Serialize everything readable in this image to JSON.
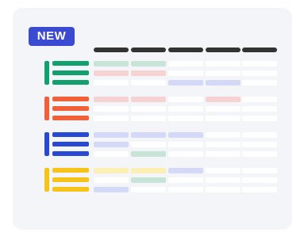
{
  "badge": {
    "label": "NEW"
  },
  "colors": {
    "badge_bg": "#3b4bd1",
    "header": "#333333",
    "green": "#13a06f",
    "orange": "#f0613a",
    "blue": "#2749d6",
    "yellow": "#f7c319",
    "tint_green": "#c8e4d6",
    "tint_red": "#f6d3d2",
    "tint_blue": "#d4d9f7",
    "tint_yellow": "#fbefb3"
  },
  "groups": [
    {
      "name": "green-group",
      "icon_color": "#13a06f",
      "rows": [
        [
          "#c8e4d6",
          "#c8e4d6",
          "#ffffff",
          "#ffffff",
          "#ffffff"
        ],
        [
          "#f6d3d2",
          "#f6d3d2",
          "#ffffff",
          "#ffffff",
          "#ffffff"
        ],
        [
          "#ffffff",
          "#ffffff",
          "#d4d9f7",
          "#d4d9f7",
          "#ffffff"
        ]
      ]
    },
    {
      "name": "orange-group",
      "icon_color": "#f0613a",
      "rows": [
        [
          "#f6d3d2",
          "#f6d3d2",
          "#ffffff",
          "#f6d3d2",
          "#ffffff"
        ],
        [
          "#ffffff",
          "#ffffff",
          "#ffffff",
          "#ffffff",
          "#ffffff"
        ],
        [
          "#ffffff",
          "#ffffff",
          "#ffffff",
          "#ffffff",
          "#ffffff"
        ]
      ]
    },
    {
      "name": "blue-group",
      "icon_color": "#2749d6",
      "rows": [
        [
          "#d4d9f7",
          "#d4d9f7",
          "#d4d9f7",
          "#ffffff",
          "#ffffff"
        ],
        [
          "#d4d9f7",
          "#ffffff",
          "#ffffff",
          "#ffffff",
          "#ffffff"
        ],
        [
          "#ffffff",
          "#c8e4d6",
          "#ffffff",
          "#ffffff",
          "#ffffff"
        ]
      ]
    },
    {
      "name": "yellow-group",
      "icon_color": "#f7c319",
      "rows": [
        [
          "#fbefb3",
          "#fbefb3",
          "#d4d9f7",
          "#ffffff",
          "#ffffff"
        ],
        [
          "#ffffff",
          "#c8e4d6",
          "#ffffff",
          "#ffffff",
          "#ffffff"
        ],
        [
          "#d4d9f7",
          "#ffffff",
          "#ffffff",
          "#ffffff",
          "#ffffff"
        ]
      ]
    }
  ]
}
